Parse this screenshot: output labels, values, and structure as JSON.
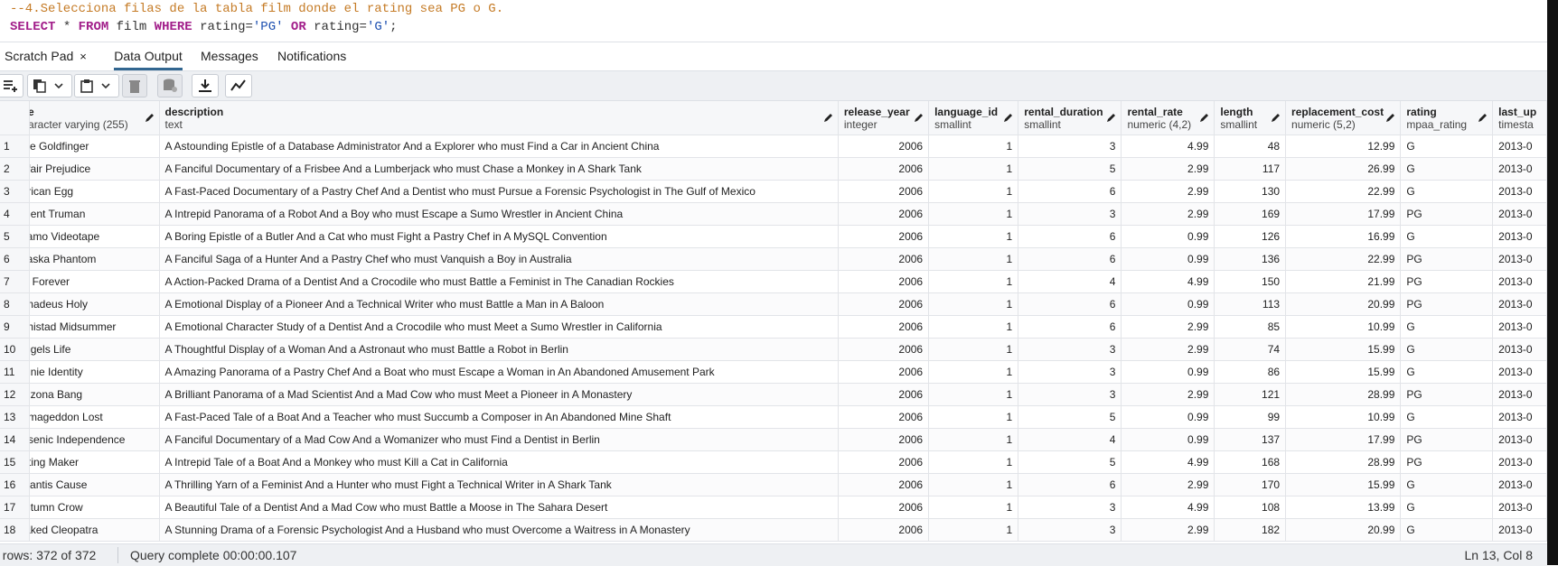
{
  "editor": {
    "comment_line": "--4.Selecciona filas de la tabla film donde el rating sea PG o G.",
    "sql": {
      "select": "SELECT",
      "star": " * ",
      "from": "FROM",
      "table": " film ",
      "where": "WHERE",
      "cond1_col": " rating=",
      "cond1_val": "'PG'",
      "or": " OR",
      "cond2_col": " rating=",
      "cond2_val": "'G'",
      "end": ";"
    }
  },
  "tabs": [
    {
      "label": "Scratch Pad",
      "close": "×"
    },
    {
      "label": "Data Output"
    },
    {
      "label": "Messages"
    },
    {
      "label": "Notifications"
    }
  ],
  "toolbar": {
    "icons": [
      "add-row-icon",
      "copy-icon",
      "chevron-down-icon",
      "paste-icon",
      "chevron-down-icon",
      "delete-icon",
      "save-data-icon",
      "download-icon",
      "graph-icon"
    ]
  },
  "grid": {
    "columns": [
      {
        "name": "e",
        "type": "aracter varying (255)"
      },
      {
        "name": "description",
        "type": "text"
      },
      {
        "name": "release_year",
        "type": "integer"
      },
      {
        "name": "language_id",
        "type": "smallint"
      },
      {
        "name": "rental_duration",
        "type": "smallint"
      },
      {
        "name": "rental_rate",
        "type": "numeric (4,2)"
      },
      {
        "name": "length",
        "type": "smallint"
      },
      {
        "name": "replacement_cost",
        "type": "numeric (5,2)"
      },
      {
        "name": "rating",
        "type": "mpaa_rating"
      },
      {
        "name": "last_up",
        "type": "timesta"
      }
    ],
    "rows": [
      {
        "n": "1",
        "title": "ce Goldfinger",
        "description": "A Astounding Epistle of a Database Administrator And a Explorer who must Find a Car in Ancient China",
        "release_year": "2006",
        "language_id": "1",
        "rental_duration": "3",
        "rental_rate": "4.99",
        "length": "48",
        "replacement_cost": "12.99",
        "rating": "G",
        "last_update": "2013-0"
      },
      {
        "n": "2",
        "title": "ffair Prejudice",
        "description": "A Fanciful Documentary of a Frisbee And a Lumberjack who must Chase a Monkey in A Shark Tank",
        "release_year": "2006",
        "language_id": "1",
        "rental_duration": "5",
        "rental_rate": "2.99",
        "length": "117",
        "replacement_cost": "26.99",
        "rating": "G",
        "last_update": "2013-0"
      },
      {
        "n": "3",
        "title": "frican Egg",
        "description": "A Fast-Paced Documentary of a Pastry Chef And a Dentist who must Pursue a Forensic Psychologist in The Gulf of Mexico",
        "release_year": "2006",
        "language_id": "1",
        "rental_duration": "6",
        "rental_rate": "2.99",
        "length": "130",
        "replacement_cost": "22.99",
        "rating": "G",
        "last_update": "2013-0"
      },
      {
        "n": "4",
        "title": "gent Truman",
        "description": "A Intrepid Panorama of a Robot And a Boy who must Escape a Sumo Wrestler in Ancient China",
        "release_year": "2006",
        "language_id": "1",
        "rental_duration": "3",
        "rental_rate": "2.99",
        "length": "169",
        "replacement_cost": "17.99",
        "rating": "PG",
        "last_update": "2013-0"
      },
      {
        "n": "5",
        "title": "lamo Videotape",
        "description": "A Boring Epistle of a Butler And a Cat who must Fight a Pastry Chef in A MySQL Convention",
        "release_year": "2006",
        "language_id": "1",
        "rental_duration": "6",
        "rental_rate": "0.99",
        "length": "126",
        "replacement_cost": "16.99",
        "rating": "G",
        "last_update": "2013-0"
      },
      {
        "n": "6",
        "title": "laska Phantom",
        "description": "A Fanciful Saga of a Hunter And a Pastry Chef who must Vanquish a Boy in Australia",
        "release_year": "2006",
        "language_id": "1",
        "rental_duration": "6",
        "rental_rate": "0.99",
        "length": "136",
        "replacement_cost": "22.99",
        "rating": "PG",
        "last_update": "2013-0"
      },
      {
        "n": "7",
        "title": "ll Forever",
        "description": "A Action-Packed Drama of a Dentist And a Crocodile who must Battle a Feminist in The Canadian Rockies",
        "release_year": "2006",
        "language_id": "1",
        "rental_duration": "4",
        "rental_rate": "4.99",
        "length": "150",
        "replacement_cost": "21.99",
        "rating": "PG",
        "last_update": "2013-0"
      },
      {
        "n": "8",
        "title": "madeus Holy",
        "description": "A Emotional Display of a Pioneer And a Technical Writer who must Battle a Man in A Baloon",
        "release_year": "2006",
        "language_id": "1",
        "rental_duration": "6",
        "rental_rate": "0.99",
        "length": "113",
        "replacement_cost": "20.99",
        "rating": "PG",
        "last_update": "2013-0"
      },
      {
        "n": "9",
        "title": "mistad Midsummer",
        "description": "A Emotional Character Study of a Dentist And a Crocodile who must Meet a Sumo Wrestler in California",
        "release_year": "2006",
        "language_id": "1",
        "rental_duration": "6",
        "rental_rate": "2.99",
        "length": "85",
        "replacement_cost": "10.99",
        "rating": "G",
        "last_update": "2013-0"
      },
      {
        "n": "10",
        "title": "ngels Life",
        "description": "A Thoughtful Display of a Woman And a Astronaut who must Battle a Robot in Berlin",
        "release_year": "2006",
        "language_id": "1",
        "rental_duration": "3",
        "rental_rate": "2.99",
        "length": "74",
        "replacement_cost": "15.99",
        "rating": "G",
        "last_update": "2013-0"
      },
      {
        "n": "11",
        "title": "nnie Identity",
        "description": "A Amazing Panorama of a Pastry Chef And a Boat who must Escape a Woman in An Abandoned Amusement Park",
        "release_year": "2006",
        "language_id": "1",
        "rental_duration": "3",
        "rental_rate": "0.99",
        "length": "86",
        "replacement_cost": "15.99",
        "rating": "G",
        "last_update": "2013-0"
      },
      {
        "n": "12",
        "title": "rizona Bang",
        "description": "A Brilliant Panorama of a Mad Scientist And a Mad Cow who must Meet a Pioneer in A Monastery",
        "release_year": "2006",
        "language_id": "1",
        "rental_duration": "3",
        "rental_rate": "2.99",
        "length": "121",
        "replacement_cost": "28.99",
        "rating": "PG",
        "last_update": "2013-0"
      },
      {
        "n": "13",
        "title": "rmageddon Lost",
        "description": "A Fast-Paced Tale of a Boat And a Teacher who must Succumb a Composer in An Abandoned Mine Shaft",
        "release_year": "2006",
        "language_id": "1",
        "rental_duration": "5",
        "rental_rate": "0.99",
        "length": "99",
        "replacement_cost": "10.99",
        "rating": "G",
        "last_update": "2013-0"
      },
      {
        "n": "14",
        "title": "rsenic Independence",
        "description": "A Fanciful Documentary of a Mad Cow And a Womanizer who must Find a Dentist in Berlin",
        "release_year": "2006",
        "language_id": "1",
        "rental_duration": "4",
        "rental_rate": "0.99",
        "length": "137",
        "replacement_cost": "17.99",
        "rating": "PG",
        "last_update": "2013-0"
      },
      {
        "n": "15",
        "title": "rting Maker",
        "description": "A Intrepid Tale of a Boat And a Monkey who must Kill a Cat in California",
        "release_year": "2006",
        "language_id": "1",
        "rental_duration": "5",
        "rental_rate": "4.99",
        "length": "168",
        "replacement_cost": "28.99",
        "rating": "PG",
        "last_update": "2013-0"
      },
      {
        "n": "16",
        "title": "tlantis Cause",
        "description": "A Thrilling Yarn of a Feminist And a Hunter who must Fight a Technical Writer in A Shark Tank",
        "release_year": "2006",
        "language_id": "1",
        "rental_duration": "6",
        "rental_rate": "2.99",
        "length": "170",
        "replacement_cost": "15.99",
        "rating": "G",
        "last_update": "2013-0"
      },
      {
        "n": "17",
        "title": "utumn Crow",
        "description": "A Beautiful Tale of a Dentist And a Mad Cow who must Battle a Moose in The Sahara Desert",
        "release_year": "2006",
        "language_id": "1",
        "rental_duration": "3",
        "rental_rate": "4.99",
        "length": "108",
        "replacement_cost": "13.99",
        "rating": "G",
        "last_update": "2013-0"
      },
      {
        "n": "18",
        "title": "aked Cleopatra",
        "description": "A Stunning Drama of a Forensic Psychologist And a Husband who must Overcome a Waitress in A Monastery",
        "release_year": "2006",
        "language_id": "1",
        "rental_duration": "3",
        "rental_rate": "2.99",
        "length": "182",
        "replacement_cost": "20.99",
        "rating": "G",
        "last_update": "2013-0"
      }
    ]
  },
  "status": {
    "rows": "al rows: 372 of 372",
    "query": "Query complete 00:00:00.107",
    "position": "Ln 13, Col 8"
  },
  "colors": {
    "comment": "#c57b26",
    "keyword": "#a21e8a",
    "string": "#1c4fb0",
    "active_tab": "#326690"
  }
}
